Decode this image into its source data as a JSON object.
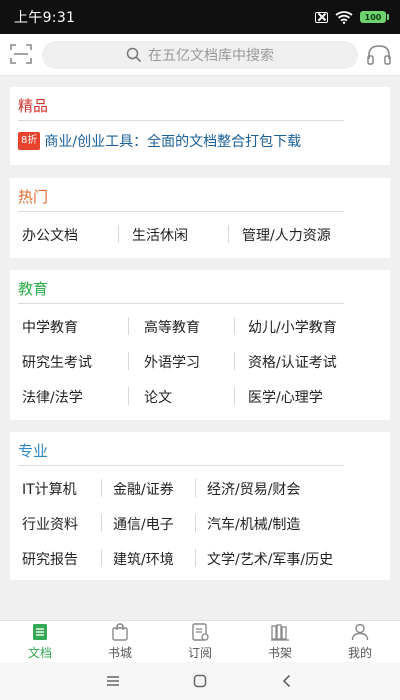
{
  "status_bar": {
    "time": "上午9:31",
    "battery": "100"
  },
  "search": {
    "placeholder": "在五亿文档库中搜索"
  },
  "featured": {
    "title": "精品",
    "deal_badge": "8折",
    "deal_text": "商业/创业工具：全面的文档整合打包下载",
    "colors": {
      "title": "#d0332e",
      "badge": "#e8412c",
      "link": "#1a5f9a"
    }
  },
  "hot": {
    "title": "热门",
    "items": [
      "办公文档",
      "生活休闲",
      "管理/人力资源"
    ],
    "color": "#e2682c"
  },
  "education": {
    "title": "教育",
    "rows": [
      [
        "中学教育",
        "高等教育",
        "幼儿/小学教育"
      ],
      [
        "研究生考试",
        "外语学习",
        "资格/认证考试"
      ],
      [
        "法律/法学",
        "论文",
        "医学/心理学"
      ]
    ],
    "color": "#2eae4a"
  },
  "professional": {
    "title": "专业",
    "rows": [
      [
        "IT计算机",
        "金融/证券",
        "经济/贸易/财会"
      ],
      [
        "行业资料",
        "通信/电子",
        "汽车/机械/制造"
      ],
      [
        "研究报告",
        "建筑/环境",
        "文学/艺术/军事/历史"
      ]
    ],
    "color": "#2f88c8"
  },
  "bottom_nav": {
    "items": [
      {
        "label": "文档",
        "icon": "document-icon",
        "active": true
      },
      {
        "label": "书城",
        "icon": "bag-icon",
        "active": false
      },
      {
        "label": "订阅",
        "icon": "subscribe-icon",
        "active": false
      },
      {
        "label": "书架",
        "icon": "bookshelf-icon",
        "active": false
      },
      {
        "label": "我的",
        "icon": "person-icon",
        "active": false
      }
    ],
    "active_color": "#34a853"
  }
}
